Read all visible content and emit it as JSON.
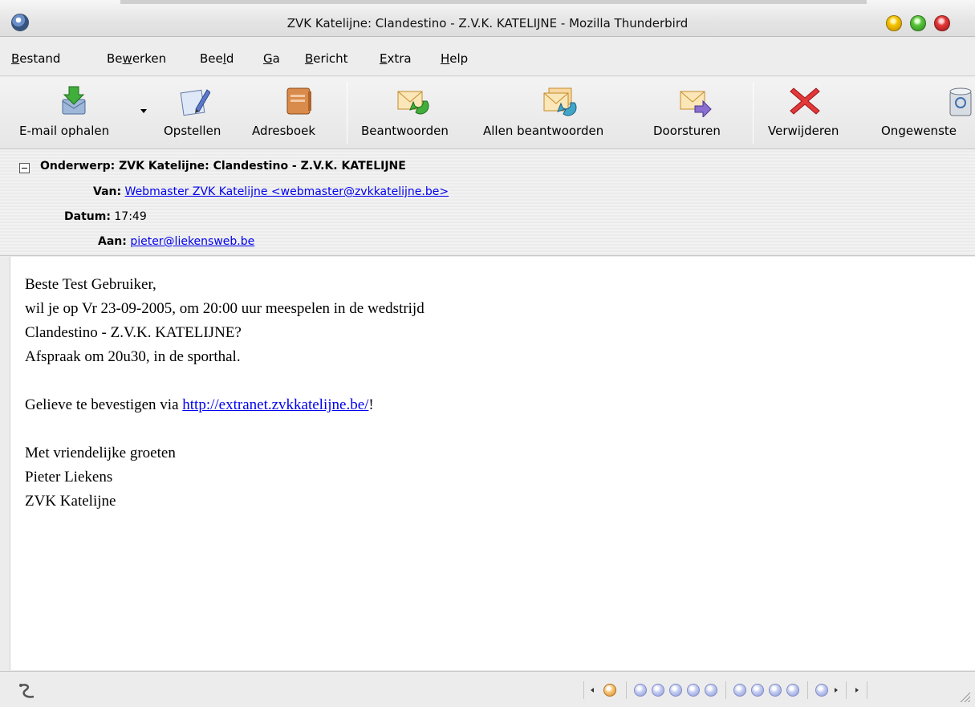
{
  "window": {
    "title": "ZVK Katelijne: Clandestino - Z.V.K. KATELIJNE - Mozilla Thunderbird"
  },
  "menu": [
    {
      "label": "Bestand",
      "accel": "B"
    },
    {
      "label": "Bewerken",
      "accel": "w"
    },
    {
      "label": "Beeld",
      "accel": "l"
    },
    {
      "label": "Ga",
      "accel": "G"
    },
    {
      "label": "Bericht",
      "accel": "B"
    },
    {
      "label": "Extra",
      "accel": "E"
    },
    {
      "label": "Help",
      "accel": "H"
    }
  ],
  "toolbar": {
    "get_mail": "E-mail ophalen",
    "compose": "Opstellen",
    "address_book": "Adresboek",
    "reply": "Beantwoorden",
    "reply_all": "Allen beantwoorden",
    "forward": "Doorsturen",
    "delete": "Verwijderen",
    "junk": "Ongewenste"
  },
  "header": {
    "subject_label": "Onderwerp:",
    "subject": "ZVK Katelijne: Clandestino - Z.V.K. KATELIJNE",
    "from_label": "Van:",
    "from": "Webmaster ZVK Katelijne <webmaster@zvkkatelijne.be>",
    "date_label": "Datum:",
    "date": "17:49",
    "to_label": "Aan:",
    "to": "pieter@liekensweb.be"
  },
  "body": {
    "line1": "Beste Test Gebruiker,",
    "line2": "wil je op Vr 23-09-2005, om 20:00 uur meespelen in de wedstrijd",
    "line3": "Clandestino - Z.V.K. KATELIJNE?",
    "line4": "Afspraak om 20u30, in de sporthal.",
    "confirm_prefix": "Gelieve te bevestigen via ",
    "confirm_link": "http://extranet.zvkkatelijne.be/",
    "confirm_suffix": "!",
    "closing1": "Met vriendelijke groeten",
    "closing2": "Pieter Liekens",
    "closing3": "ZVK Katelijne"
  },
  "colors": {
    "link": "#0000ee",
    "traffic_yellow": "#f5c400",
    "traffic_green": "#59c53b",
    "traffic_red": "#e2383a"
  },
  "icons": [
    "get-mail-icon",
    "compose-icon",
    "address-book-icon",
    "reply-icon",
    "reply-all-icon",
    "forward-icon",
    "delete-icon",
    "junk-icon",
    "online-status-icon"
  ]
}
